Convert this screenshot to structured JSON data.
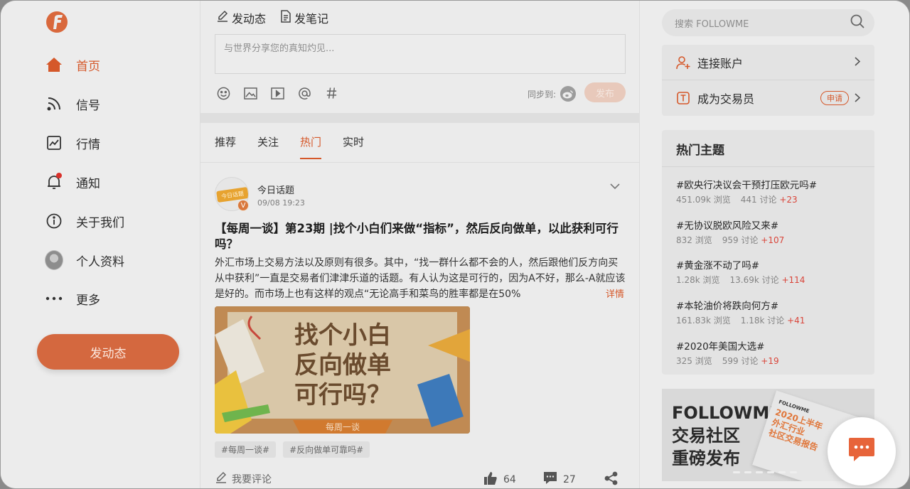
{
  "colors": {
    "accent": "#d5582a",
    "plus": "#d9453a",
    "overlay_bg": "#e9e9e9"
  },
  "sidebar": {
    "logo_icon": "followme-logo-icon",
    "items": [
      {
        "label": "首页",
        "icon": "home-icon",
        "active": true
      },
      {
        "label": "信号",
        "icon": "rss-signal-icon"
      },
      {
        "label": "行情",
        "icon": "chart-line-icon"
      },
      {
        "label": "通知",
        "icon": "bell-icon",
        "has_dot": true
      },
      {
        "label": "关于我们",
        "icon": "info-icon"
      },
      {
        "label": "个人资料",
        "icon": "avatar-icon"
      },
      {
        "label": "更多",
        "icon": "more-dots-icon"
      }
    ],
    "post_button": "发动态"
  },
  "composer": {
    "tab_status": "发动态",
    "tab_note": "发笔记",
    "placeholder": "与世界分享您的真知灼见...",
    "tools": [
      "emoji-icon",
      "image-icon",
      "video-icon",
      "mention-icon",
      "hashtag-icon"
    ],
    "sync_label": "同步到:",
    "publish": "发布"
  },
  "feed": {
    "tabs": [
      "推荐",
      "关注",
      "热门",
      "实时"
    ],
    "active_tab": "热门",
    "post": {
      "avatar_tag": "今日话题",
      "author": "今日话题",
      "time": "09/08 19:23",
      "title": "【每周一谈】第23期 |找个小白们来做“指标”，然后反向做单，以此获利可行吗？",
      "body": "外汇市场上交易方法以及原则有很多。其中，“找一群什么都不会的人，然后跟他们反方向买从中获利”一直是交易者们津津乐道的话题。有人认为这是可行的，因为A不好，那么-A就应该是好的。而市场上也有这样的观点“无论高手和菜鸟的胜率都是在50%",
      "more": "详情",
      "image": {
        "line1": "找个小白",
        "line2": "反向做单",
        "line3": "可行吗？",
        "ribbon": "每周一谈"
      },
      "tags": [
        "#每周一谈#",
        "#反向做单可靠吗#"
      ],
      "comment_entry": "我要评论",
      "likes": "64",
      "comments": "27"
    }
  },
  "right": {
    "search_placeholder": "搜索 FOLLOWME",
    "account": {
      "connect": "连接账户",
      "become_trader": "成为交易员",
      "apply_badge": "申请"
    },
    "hot": {
      "title": "热门主题",
      "items": [
        {
          "name": "#欧央行决议会干预打压欧元吗#",
          "views": "451.09k 浏览",
          "discuss": "441 讨论",
          "plus": "+23"
        },
        {
          "name": "#无协议脱欧风险又来#",
          "views": "832 浏览",
          "discuss": "959 讨论",
          "plus": "+107"
        },
        {
          "name": "#黄金涨不动了吗#",
          "views": "1.28k 浏览",
          "discuss": "13.69k 讨论",
          "plus": "+114"
        },
        {
          "name": "#本轮油价将跌向何方#",
          "views": "161.83k 浏览",
          "discuss": "1.18k 讨论",
          "plus": "+41"
        },
        {
          "name": "#2020年美国大选#",
          "views": "325 浏览",
          "discuss": "599 讨论",
          "plus": "+19"
        }
      ]
    },
    "banner": {
      "line1": "FOLLOWME",
      "line2": "交易社区",
      "line3": "重磅发布",
      "card_brand": "FOLLOWME",
      "card_line1": "2020上半年",
      "card_line2": "外汇行业",
      "card_line3": "社区交易报告"
    }
  }
}
